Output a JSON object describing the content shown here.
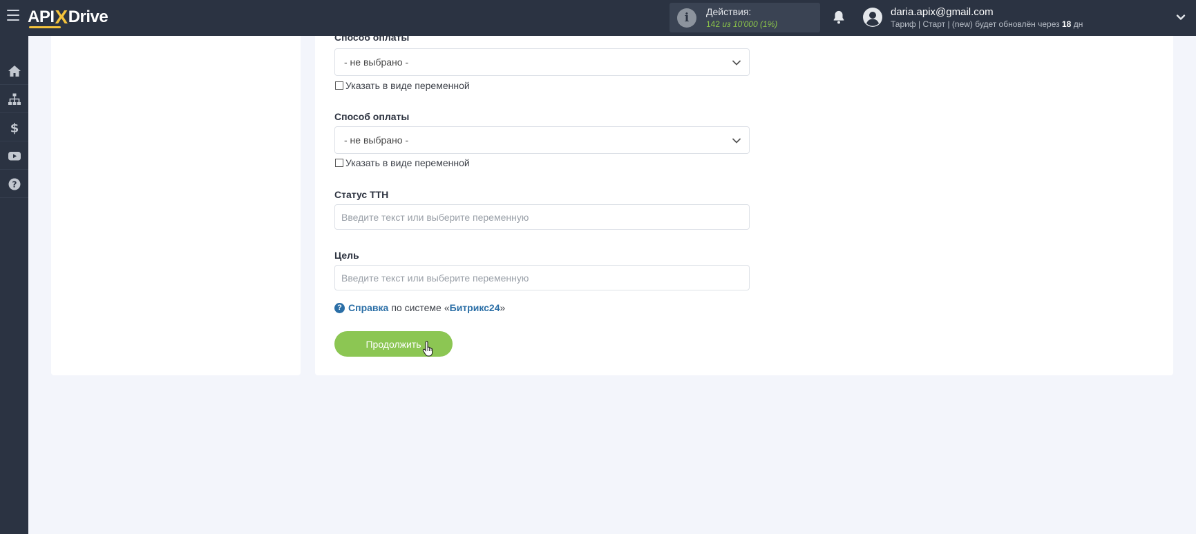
{
  "header": {
    "logo_left": "API",
    "logo_x": "X",
    "logo_right": "Drive",
    "actions_title": "Действия:",
    "actions_current": "142",
    "actions_of": "из 10'000 (1%)",
    "user_email": "daria.apix@gmail.com",
    "plan_text": "Тариф | Старт | (new) будет обновлён через",
    "plan_days": "18",
    "plan_unit": "дн",
    "icons": [
      "menu-icon",
      "info-icon",
      "bell-icon",
      "user-icon",
      "chevron-down-icon"
    ]
  },
  "sidebar": {
    "items": [
      {
        "icon": "home-icon"
      },
      {
        "icon": "sitemap-icon"
      },
      {
        "icon": "dollar-icon"
      },
      {
        "icon": "youtube-icon"
      },
      {
        "icon": "help-icon"
      }
    ]
  },
  "form": {
    "payment1": {
      "label": "Способ оплаты",
      "value": "- не выбрано -",
      "checkbox_label": "Указать в виде переменной"
    },
    "payment2": {
      "label": "Способ оплаты",
      "value": "- не выбрано -",
      "checkbox_label": "Указать в виде переменной"
    },
    "ttn_status": {
      "label": "Статус ТТН",
      "placeholder": "Введите текст или выберите переменную",
      "value": ""
    },
    "goal": {
      "label": "Цель",
      "placeholder": "Введите текст или выберите переменную",
      "value": ""
    },
    "help": {
      "link": "Справка",
      "middle": "по системе",
      "open_quote": "«",
      "system": "Битрикс24",
      "close_quote": "»"
    },
    "continue_label": "Продолжить"
  },
  "colors": {
    "topbar": "#2b3342",
    "accent_yellow": "#f5c33b",
    "button_green": "#8cc653",
    "link_blue": "#2a6ea6",
    "background": "#f3f5fb"
  }
}
